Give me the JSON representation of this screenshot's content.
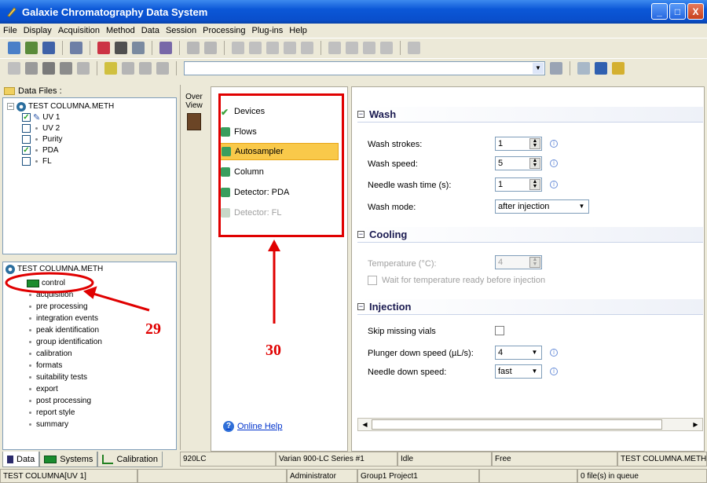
{
  "window": {
    "title": "Galaxie Chromatography Data System",
    "buttons": [
      "_",
      "□",
      "X"
    ]
  },
  "menu": [
    "File",
    "Display",
    "Acquisition",
    "Method",
    "Data",
    "Session",
    "Processing",
    "Plug-ins",
    "Help"
  ],
  "left": {
    "data_files_label": "Data Files :",
    "data_tree": {
      "root": "TEST COLUMNA.METH",
      "children": [
        {
          "label": "UV 1",
          "checked": true
        },
        {
          "label": "UV 2",
          "checked": false
        },
        {
          "label": "Purity",
          "checked": false
        },
        {
          "label": "PDA",
          "checked": true
        },
        {
          "label": "FL",
          "checked": false
        }
      ]
    },
    "method_tree": {
      "root": "TEST COLUMNA.METH",
      "items": [
        "control",
        "acquisition",
        "pre processing",
        "integration events",
        "peak identification",
        "group identification",
        "calibration",
        "formats",
        "suitability tests",
        "export",
        "post processing",
        "report style",
        "summary"
      ]
    },
    "tabs": [
      "Data",
      "Systems",
      "Calibration"
    ]
  },
  "overview": {
    "label": "Over View"
  },
  "nav": {
    "items": [
      {
        "label": "Devices",
        "state": "checked"
      },
      {
        "label": "Flows",
        "state": "normal"
      },
      {
        "label": "Autosampler",
        "state": "selected"
      },
      {
        "label": "Column",
        "state": "normal"
      },
      {
        "label": "Detector: PDA",
        "state": "normal"
      },
      {
        "label": "Detector: FL",
        "state": "disabled"
      }
    ],
    "help": "Online Help"
  },
  "settings": {
    "wash": {
      "title": "Wash",
      "strokes_label": "Wash strokes:",
      "strokes": "1",
      "speed_label": "Wash speed:",
      "speed": "5",
      "needle_label": "Needle wash time (s):",
      "needle": "1",
      "mode_label": "Wash mode:",
      "mode": "after injection"
    },
    "cooling": {
      "title": "Cooling",
      "temp_label": "Temperature (°C):",
      "temp": "4",
      "wait_label": "Wait for temperature ready before injection"
    },
    "injection": {
      "title": "Injection",
      "skip_label": "Skip missing vials",
      "plunger_label": "Plunger down speed (µL/s):",
      "plunger": "4",
      "needle_label": "Needle down speed:",
      "needle": "fast"
    }
  },
  "status1": [
    "920LC",
    "Varian 900-LC Series #1",
    "Idle",
    "Free",
    "TEST COLUMNA.METH"
  ],
  "status2": [
    "TEST COLUMNA[UV 1]",
    "",
    "Administrator",
    "Group1 Project1",
    "",
    "0 file(s) in queue"
  ],
  "annotations": {
    "left": "29",
    "center": "30"
  }
}
